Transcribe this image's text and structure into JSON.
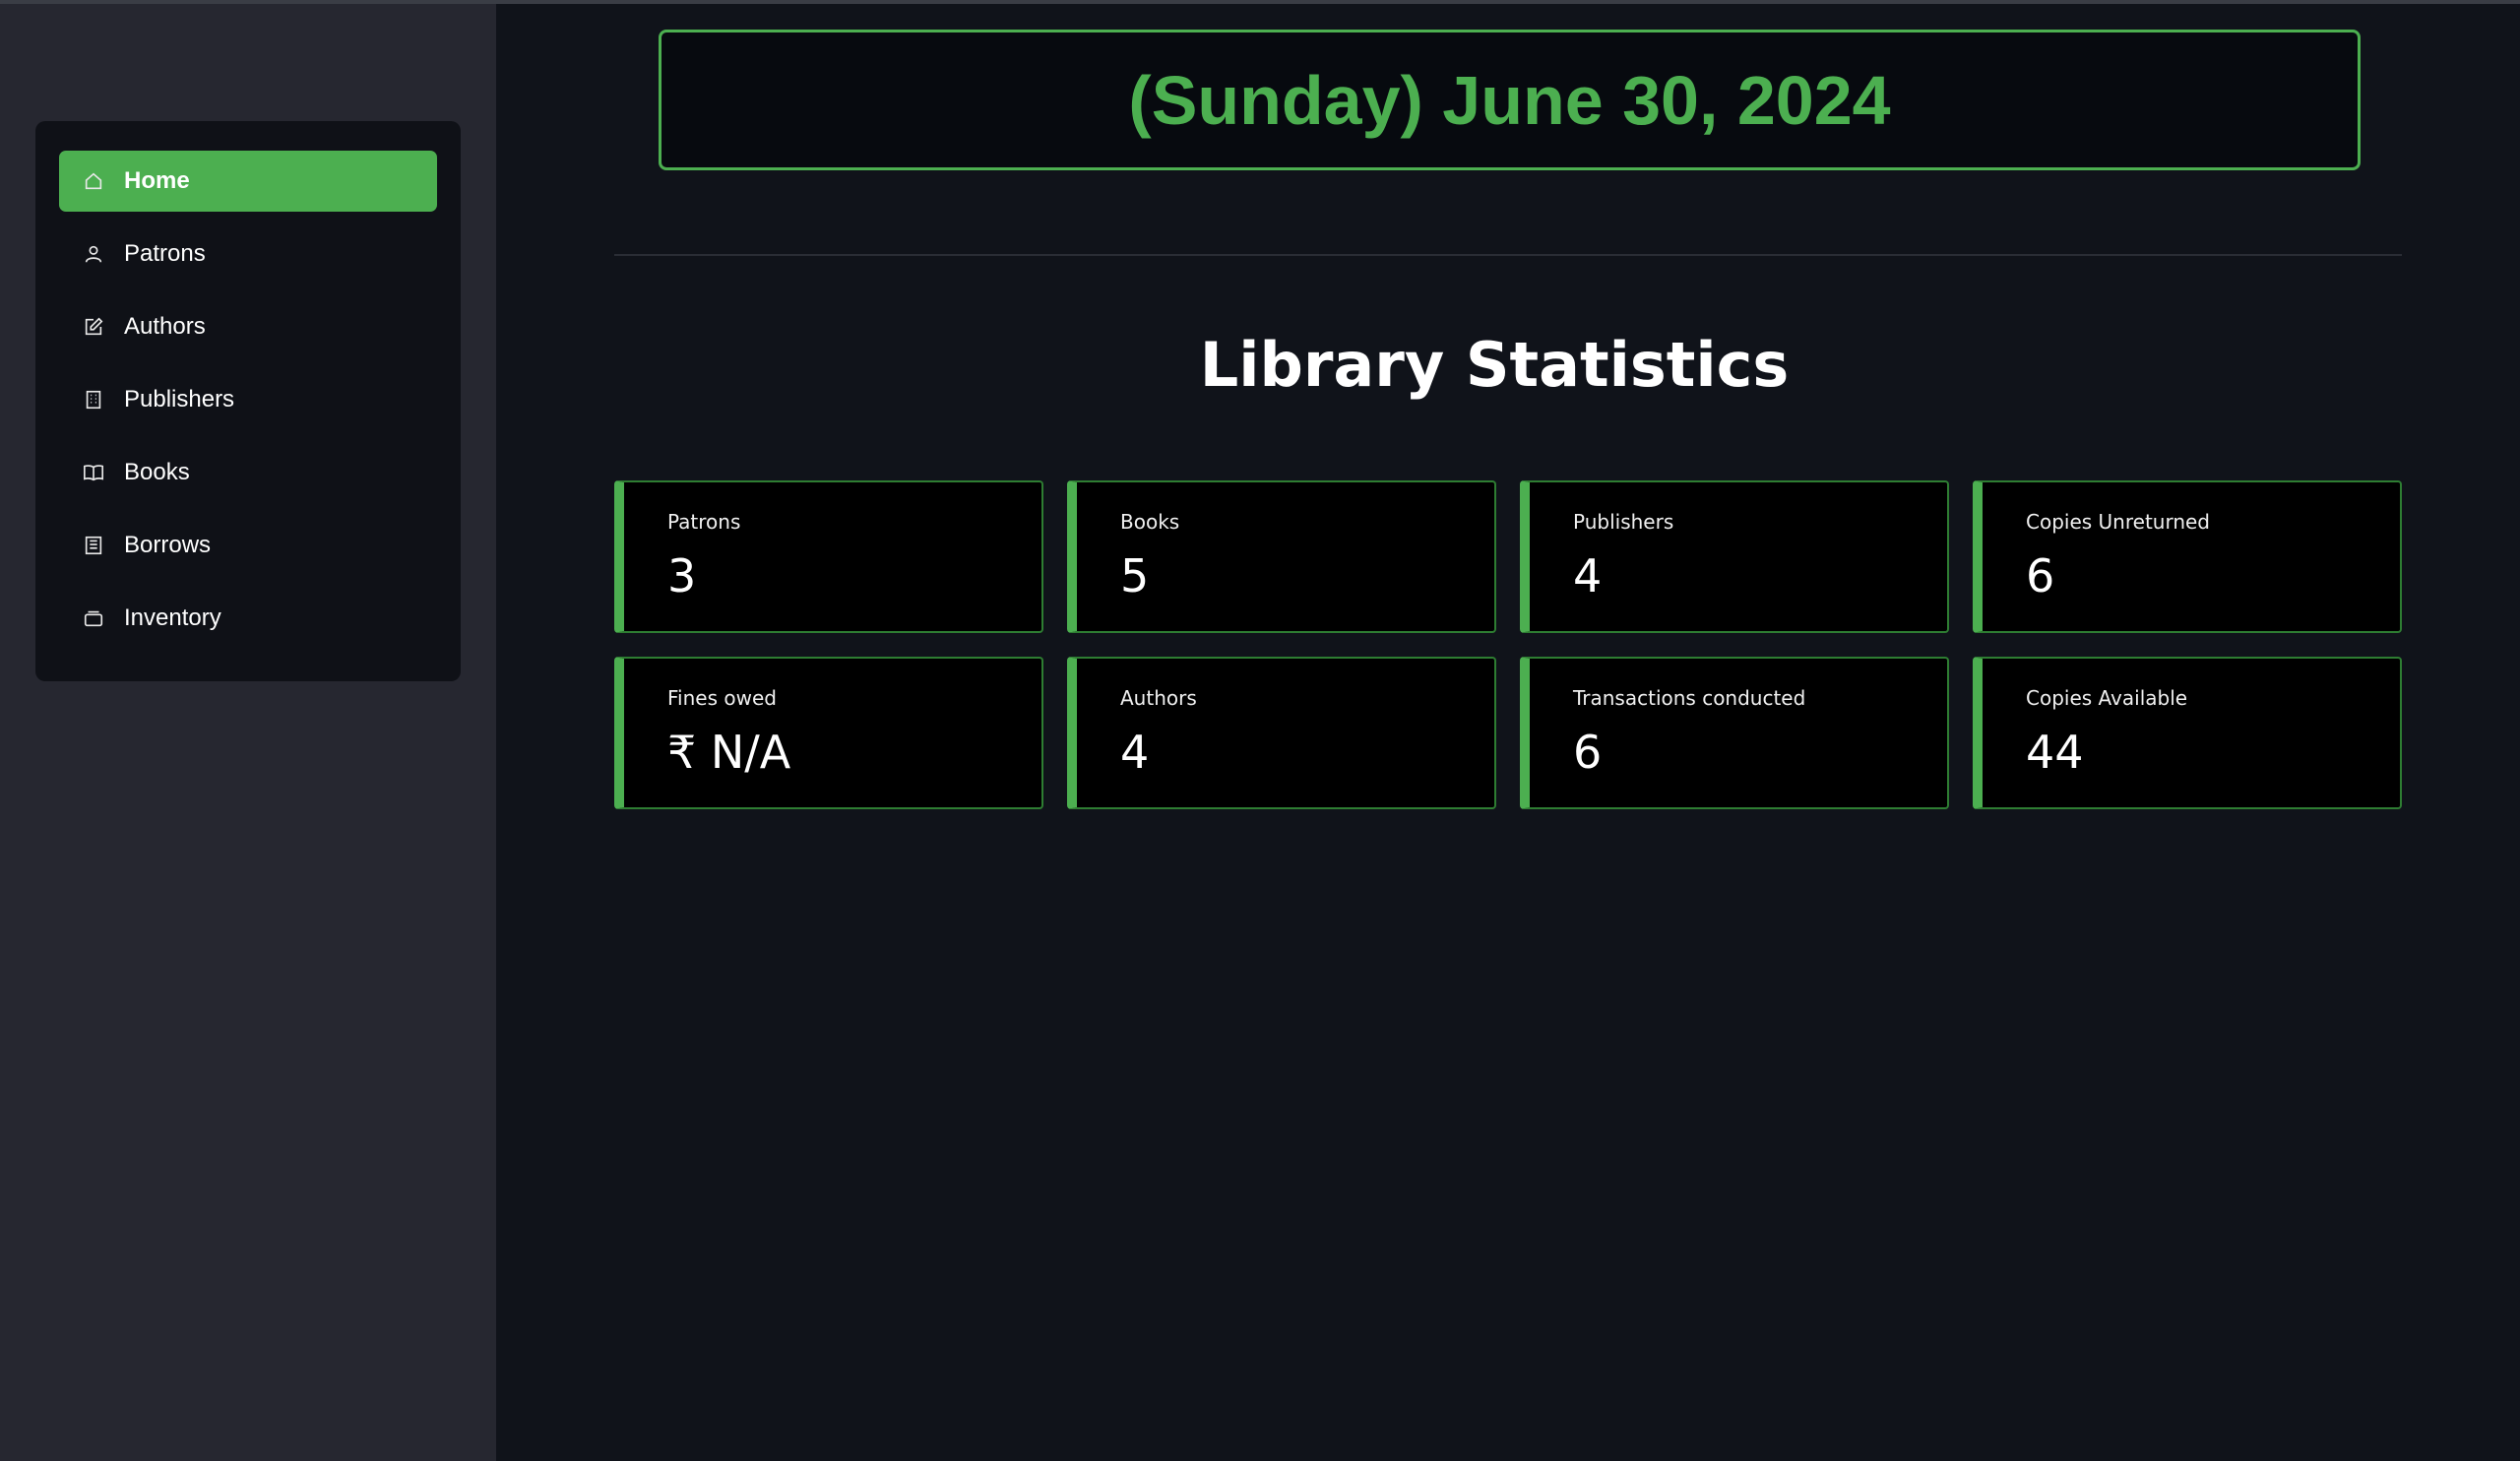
{
  "sidebar": {
    "items": [
      {
        "label": "Home",
        "icon": "home-icon",
        "active": true
      },
      {
        "label": "Patrons",
        "icon": "person-icon",
        "active": false
      },
      {
        "label": "Authors",
        "icon": "edit-icon",
        "active": false
      },
      {
        "label": "Publishers",
        "icon": "building-icon",
        "active": false
      },
      {
        "label": "Books",
        "icon": "book-icon",
        "active": false
      },
      {
        "label": "Borrows",
        "icon": "ledger-icon",
        "active": false
      },
      {
        "label": "Inventory",
        "icon": "box-icon",
        "active": false
      }
    ]
  },
  "main": {
    "date": "(Sunday) June 30, 2024",
    "title": "Library Statistics",
    "stats": [
      {
        "label": "Patrons",
        "value": "3"
      },
      {
        "label": "Books",
        "value": "5"
      },
      {
        "label": "Publishers",
        "value": "4"
      },
      {
        "label": "Copies Unreturned",
        "value": "6"
      },
      {
        "label": "Fines owed",
        "value": "₹ N/A"
      },
      {
        "label": "Authors",
        "value": "4"
      },
      {
        "label": "Transactions conducted",
        "value": "6"
      },
      {
        "label": "Copies Available",
        "value": "44"
      }
    ]
  },
  "colors": {
    "accent": "#4caf50",
    "sidebar_bg": "#262730",
    "main_bg": "#10131a",
    "card_bg": "#000000"
  }
}
